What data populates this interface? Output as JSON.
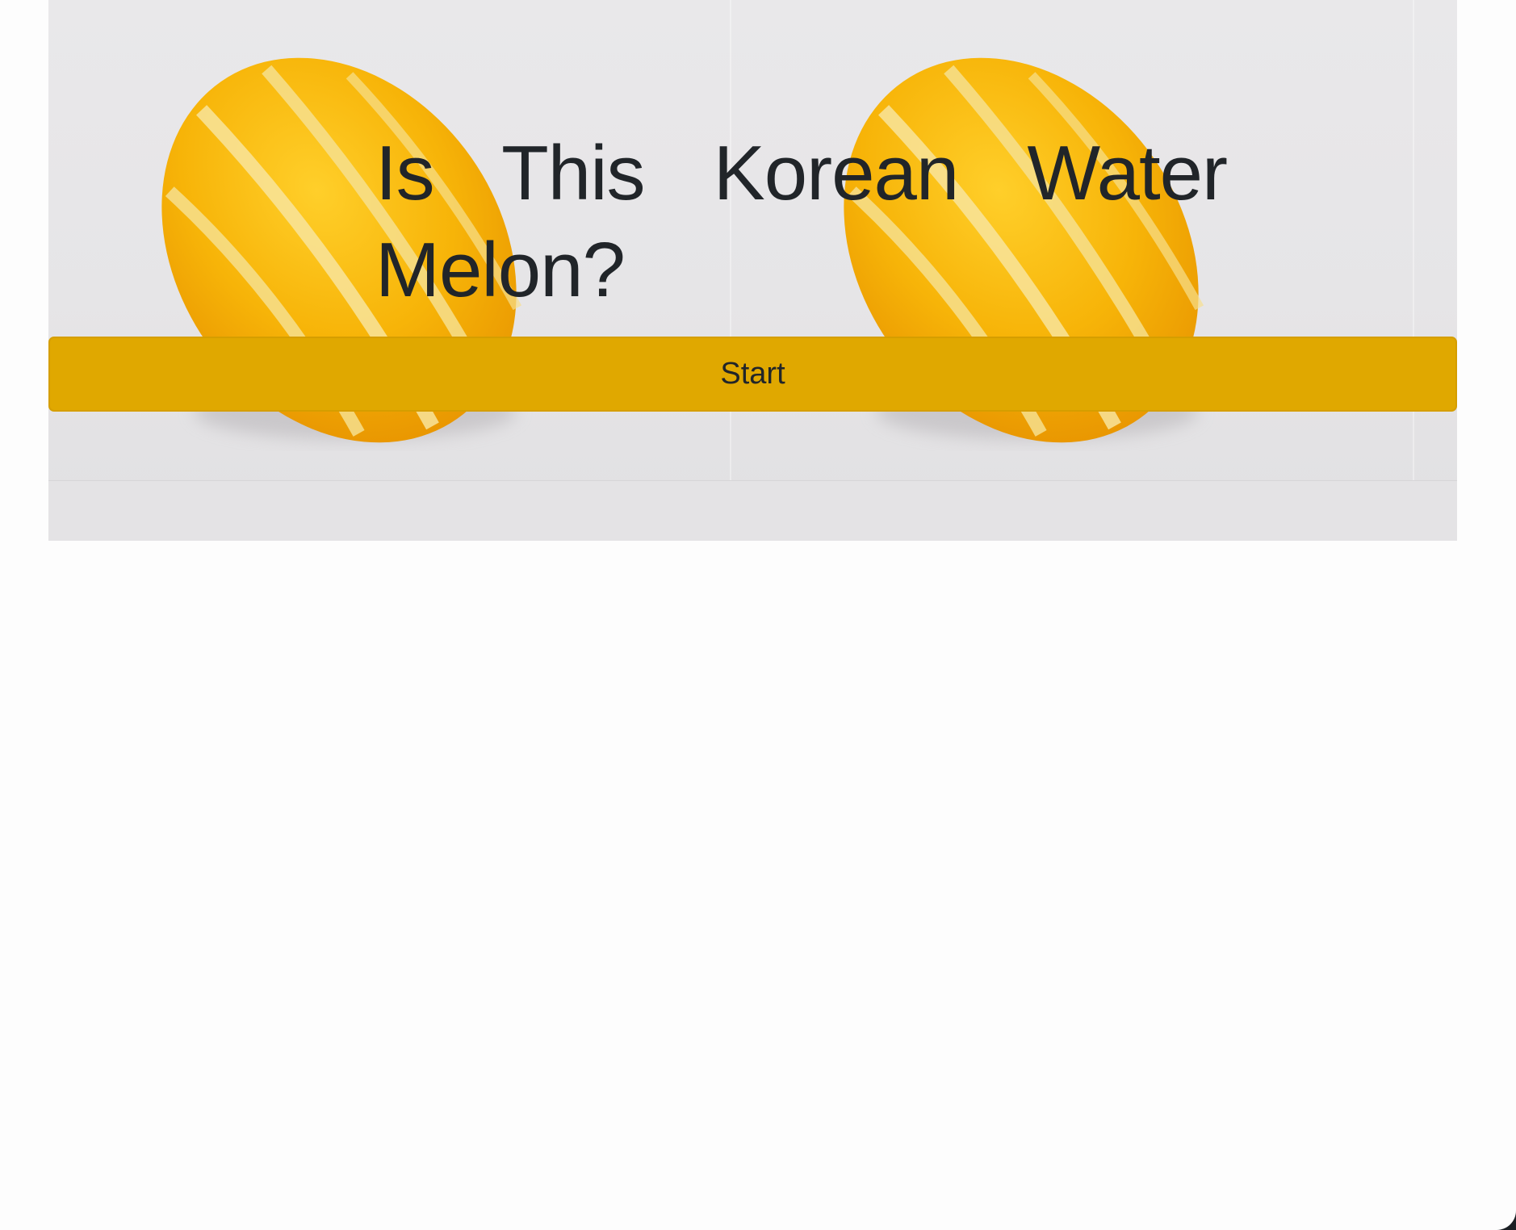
{
  "hero": {
    "title": "Is This Korean Water Melon?",
    "image": "korean-melon-photo",
    "background_color": "#e8e7e9"
  },
  "start_button": {
    "label": "Start",
    "color": "#e0a800",
    "text_color": "#212529"
  }
}
